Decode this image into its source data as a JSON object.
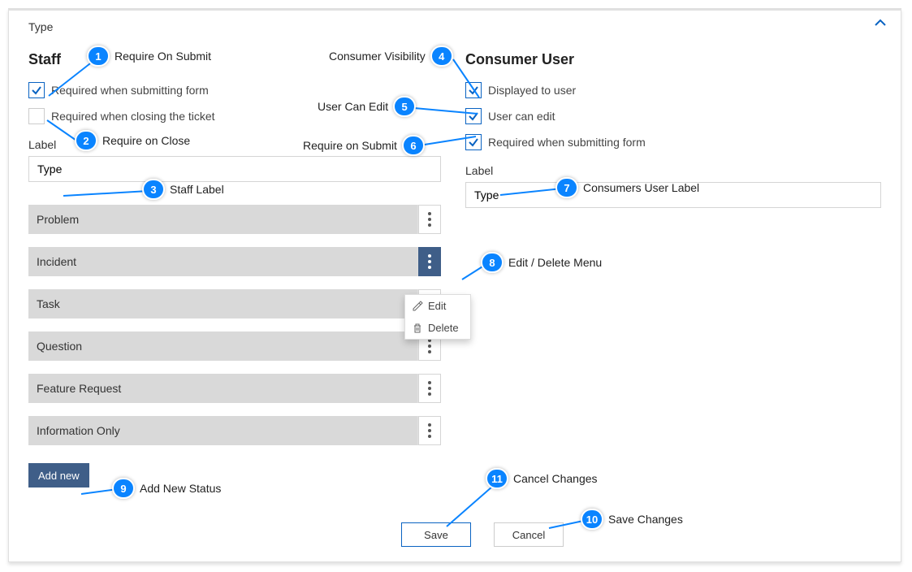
{
  "panel": {
    "title": "Type"
  },
  "staff": {
    "title": "Staff",
    "req_submit": {
      "label": "Required when submitting form",
      "checked": true
    },
    "req_close": {
      "label": "Required when closing the ticket",
      "checked": false
    },
    "label_caption": "Label",
    "label_value": "Type"
  },
  "consumer": {
    "title": "Consumer User",
    "displayed": {
      "label": "Displayed to user",
      "checked": true
    },
    "can_edit": {
      "label": "User can edit",
      "checked": true
    },
    "req_submit": {
      "label": "Required when submitting form",
      "checked": true
    },
    "label_caption": "Label",
    "label_value": "Type"
  },
  "statuses": [
    {
      "label": "Problem",
      "active": false
    },
    {
      "label": "Incident",
      "active": true
    },
    {
      "label": "Task",
      "active": false
    },
    {
      "label": "Question",
      "active": false
    },
    {
      "label": "Feature Request",
      "active": false
    },
    {
      "label": "Information Only",
      "active": false
    }
  ],
  "dropdown": {
    "edit": "Edit",
    "delete": "Delete"
  },
  "add_new": "Add new",
  "save": "Save",
  "cancel": "Cancel",
  "annots": {
    "1": "Require On Submit",
    "2": "Require on Close",
    "3": "Staff Label",
    "4": "Consumer Visibility",
    "5": "User Can Edit",
    "6": "Require on Submit",
    "7": "Consumers User Label",
    "8": "Edit / Delete Menu",
    "9": "Add New Status",
    "10": "Save Changes",
    "11": "Cancel Changes"
  }
}
